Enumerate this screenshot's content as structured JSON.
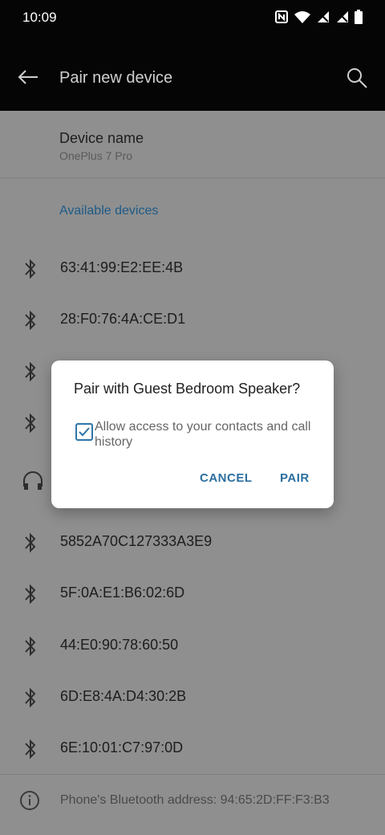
{
  "status": {
    "time": "10:09",
    "icons": [
      "nfc-icon",
      "wifi-icon",
      "signal-off-icon",
      "signal-off-icon",
      "battery-icon"
    ]
  },
  "appbar": {
    "title": "Pair new device",
    "back_icon": "back-arrow-icon",
    "search_icon": "search-icon"
  },
  "device": {
    "label": "Device name",
    "value": "OnePlus 7 Pro"
  },
  "section": "Available devices",
  "devices": [
    {
      "icon": "bluetooth-icon",
      "name": "63:41:99:E2:EE:4B"
    },
    {
      "icon": "bluetooth-icon",
      "name": "28:F0:76:4A:CE:D1"
    },
    {
      "icon": "bluetooth-icon",
      "name": ""
    },
    {
      "icon": "bluetooth-icon",
      "name": ""
    },
    {
      "icon": "headphones-icon",
      "name": ""
    },
    {
      "icon": "bluetooth-icon",
      "name": "5852A70C127333A3E9"
    },
    {
      "icon": "bluetooth-icon",
      "name": "5F:0A:E1:B6:02:6D"
    },
    {
      "icon": "bluetooth-icon",
      "name": "44:E0:90:78:60:50"
    },
    {
      "icon": "bluetooth-icon",
      "name": "6D:E8:4A:D4:30:2B"
    },
    {
      "icon": "bluetooth-icon",
      "name": "6E:10:01:C7:97:0D"
    }
  ],
  "footer": {
    "icon": "info-icon",
    "text": "Phone's Bluetooth address: 94:65:2D:FF:F3:B3"
  },
  "dialog": {
    "title": "Pair with Guest Bedroom Speaker?",
    "checkbox_label": "Allow access to your contacts and call history",
    "checked": true,
    "cancel": "CANCEL",
    "pair": "PAIR"
  },
  "colors": {
    "accent": "#2c6f9f",
    "scrim": "#8f8f8f",
    "appbar": "#050505"
  }
}
